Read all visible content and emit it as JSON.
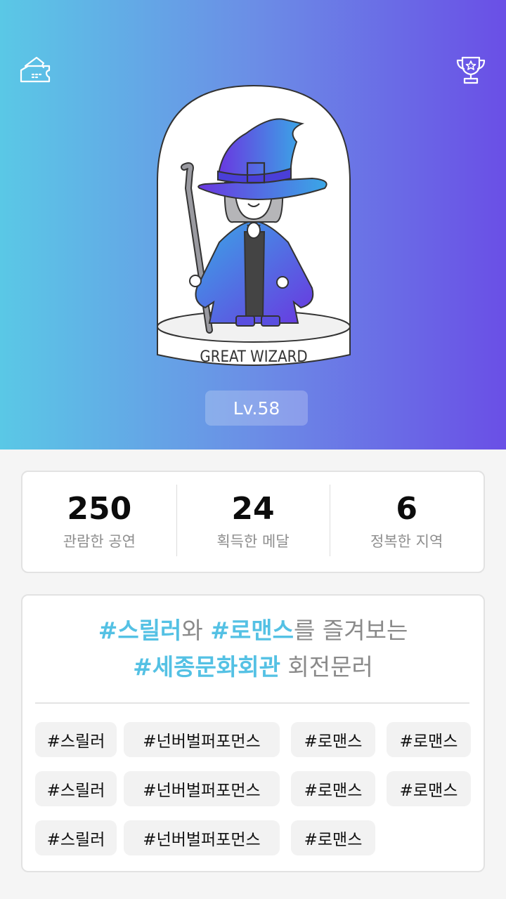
{
  "header": {
    "ticket_icon": "ticket-icon",
    "trophy_icon": "trophy-icon",
    "badge_caption": "GREAT WIZARD",
    "level": "Lv.58",
    "colors": {
      "gradient_start": "#5ac8e6",
      "gradient_end": "#6a4fe6"
    }
  },
  "stats": [
    {
      "value": "250",
      "label": "관람한 공연"
    },
    {
      "value": "24",
      "label": "획득한 메달"
    },
    {
      "value": "6",
      "label": "정복한 지역"
    }
  ],
  "taste": {
    "line1": {
      "tag1": "#스릴러",
      "mid": "와 ",
      "tag2": "#로맨스",
      "rest": "를 즐겨보는"
    },
    "line2": {
      "tag": "#세종문화회관",
      "rest": " 회전문러"
    },
    "highlight_color": "#54c1e4",
    "chips": [
      "#스릴러",
      "#넌버벌퍼포먼스",
      "#로맨스",
      "#로맨스",
      "#스릴러",
      "#넌버벌퍼포먼스",
      "#로맨스",
      "#로맨스",
      "#스릴러",
      "#넌버벌퍼포먼스",
      "#로맨스"
    ]
  }
}
